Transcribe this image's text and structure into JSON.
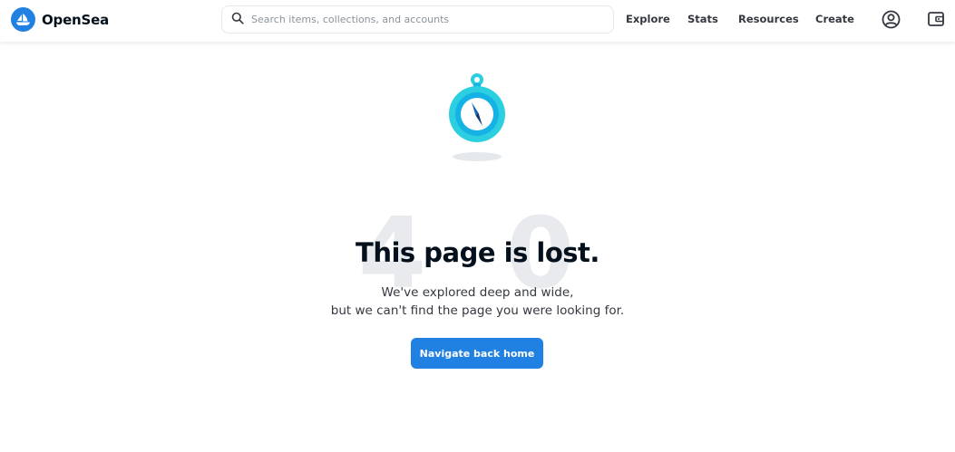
{
  "header": {
    "brand": "OpenSea",
    "search": {
      "placeholder": "Search items, collections, and accounts",
      "value": ""
    },
    "nav": {
      "explore": "Explore",
      "stats": "Stats",
      "resources": "Resources",
      "create": "Create"
    },
    "icons": {
      "account": "account-circle-icon",
      "wallet": "wallet-icon"
    }
  },
  "main": {
    "background_text": "404",
    "title": "This page is lost.",
    "subtitle_line1": "We've explored deep and wide,",
    "subtitle_line2": "but we can't find the page you were looking for.",
    "button_label": "Navigate back home"
  },
  "colors": {
    "brand_blue": "#2081e2",
    "compass_teal": "#15b2e5",
    "compass_cyan": "#2ccfe0",
    "text_dark": "#04111d"
  }
}
